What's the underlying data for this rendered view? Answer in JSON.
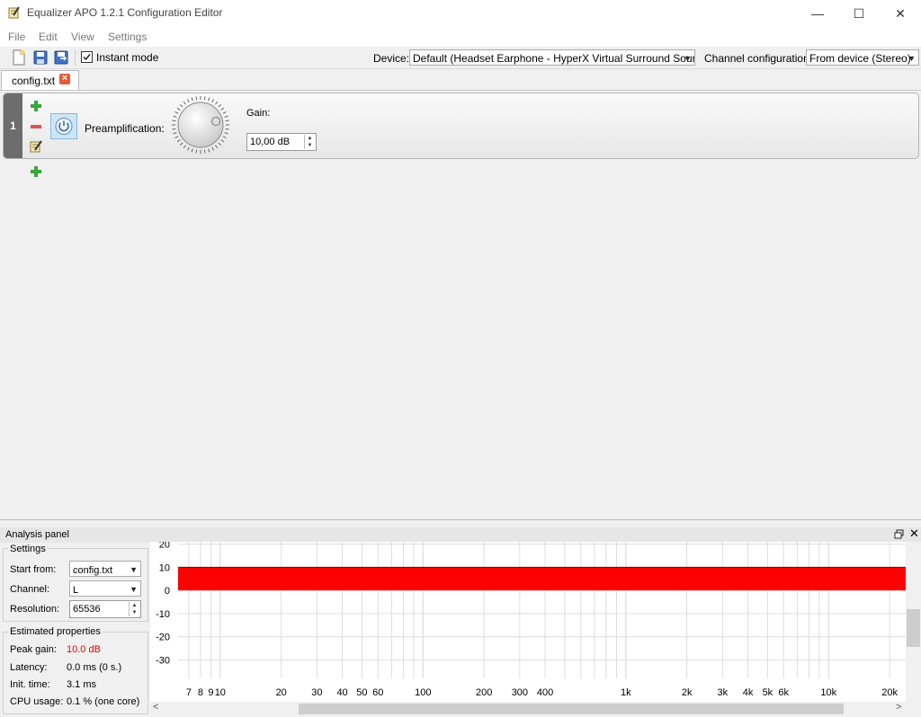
{
  "window": {
    "title": "Equalizer APO 1.2.1 Configuration Editor",
    "minimize": "—",
    "maximize": "☐",
    "close": "✕"
  },
  "menu": [
    "File",
    "Edit",
    "View",
    "Settings"
  ],
  "toolbar": {
    "instant_mode_label": "Instant mode",
    "instant_mode_checked": true,
    "device_label": "Device:",
    "device_value": "Default (Headset Earphone - HyperX Virtual Surround Sound)",
    "channel_config_label": "Channel configuration:",
    "channel_config_value": "From device (Stereo)"
  },
  "tabs": [
    {
      "label": "config.txt",
      "close": "×"
    }
  ],
  "filter": {
    "number": "1",
    "preamp_label": "Preamplification:",
    "gain_label": "Gain:",
    "gain_value": "10,00 dB"
  },
  "analysis": {
    "title": "Analysis panel",
    "settings_title": "Settings",
    "start_from_label": "Start from:",
    "start_from_value": "config.txt",
    "channel_label": "Channel:",
    "channel_value": "L",
    "resolution_label": "Resolution:",
    "resolution_value": "65536",
    "estimated_title": "Estimated properties",
    "peak_gain_label": "Peak gain:",
    "peak_gain_value": "10.0 dB",
    "latency_label": "Latency:",
    "latency_value": "0.0 ms (0 s.)",
    "init_time_label": "Init. time:",
    "init_time_value": "3.1 ms",
    "cpu_usage_label": "CPU usage:",
    "cpu_usage_value": "0.1 % (one core)"
  },
  "colors": {
    "response": "#ff0000",
    "peak_gain_text": "#e00000",
    "grid": "#dddddd"
  },
  "chart_data": {
    "type": "area",
    "xscale": "log",
    "x_ticks": [
      7,
      8,
      9,
      10,
      20,
      30,
      40,
      50,
      60,
      100,
      200,
      300,
      400,
      1000,
      2000,
      3000,
      4000,
      5000,
      6000,
      10000,
      20000
    ],
    "x_tick_labels": [
      "7",
      "8",
      "9",
      "10",
      "20",
      "30",
      "40",
      "50",
      "60",
      "100",
      "200",
      "300",
      "400",
      "1k",
      "2k",
      "3k",
      "4k",
      "5k",
      "6k",
      "10k",
      "20k"
    ],
    "y_ticks": [
      20,
      10,
      0,
      -10,
      -20,
      -30
    ],
    "xlim": [
      6.2,
      24000
    ],
    "ylim": [
      -38,
      21
    ],
    "series": [
      {
        "x": [
          6.2,
          24000
        ],
        "y": [
          10,
          10
        ],
        "baseline": 0
      }
    ]
  }
}
